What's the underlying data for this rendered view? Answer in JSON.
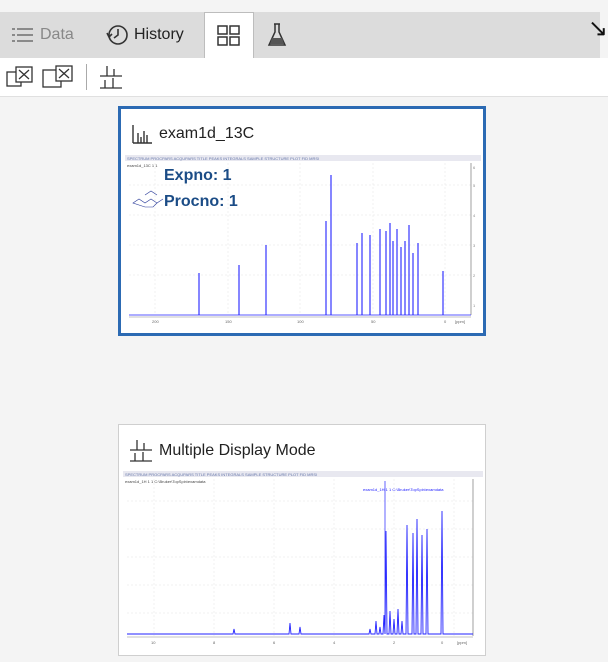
{
  "tabs": {
    "data_label": "Data",
    "history_label": "History"
  },
  "cards": [
    {
      "title": "exam1d_13C",
      "expno": "Expno: 1",
      "procno": "Procno: 1",
      "tab_strip": "SPECTRUM  PROCPARS  ACQUPARS  TITLE  PEAKS  INTEGRALS  SAMPLE  STRUCTURE  PLOT  FID  MRSI",
      "sub_caption": "exam1d_13C  1  1",
      "x_ticks": [
        "200",
        "150",
        "100",
        "50",
        "0",
        "[ppm]"
      ]
    },
    {
      "title": "Multiple Display Mode",
      "tab_strip": "SPECTRUM  PROCPARS  ACQUPARS  TITLE  PEAKS  INTEGRALS  SAMPLE  STRUCTURE  PLOT  FID  MRSI",
      "sub_caption": "exam1d_1H  1  1  C:\\Bruker\\TopSpin\\examdata",
      "legend_line": "exam1d_1H  1  1  C:\\Bruker\\TopSpin\\examdata",
      "x_ticks": [
        "10",
        "8",
        "6",
        "4",
        "2",
        "0",
        "[ppm]"
      ]
    }
  ],
  "colors": {
    "accent": "#2c6ab3",
    "spectrum": "#2222ff",
    "tabbar": "#dcdcdc"
  }
}
